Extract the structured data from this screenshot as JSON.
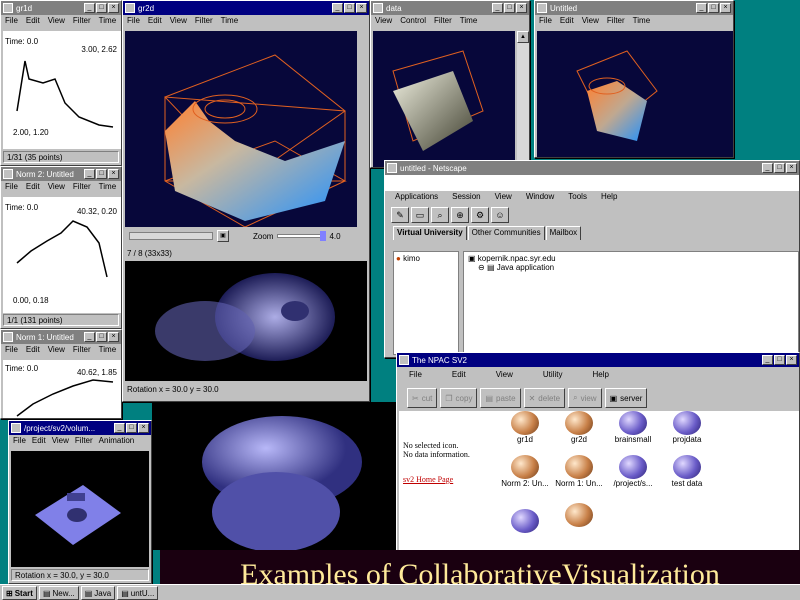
{
  "common_menu": [
    "File",
    "Edit",
    "View",
    "Filter",
    "Time"
  ],
  "win_gr1d": {
    "title": "gr1d",
    "time_label": "Time: 0.0",
    "coord_top": "3.00, 2.62",
    "coord_bottom": "2.00, 1.20",
    "status": "1/31 (35 points)"
  },
  "win_gr2d": {
    "title": "gr2d",
    "zoom_label": "Zoom",
    "slider_value": "4.0",
    "frame_label": "7 / 8 (33x33)",
    "rotation_label": "Rotation x = 30.0 y = 30.0"
  },
  "win_data": {
    "title": "data",
    "menu": [
      "View",
      "Control",
      "Filter",
      "Time"
    ]
  },
  "win_untitled_right": {
    "title": "Untitled",
    "menu": [
      "File",
      "Edit",
      "View",
      "Filter",
      "Time"
    ]
  },
  "win_norm2": {
    "title": "Norm 2: Untitled",
    "time_label": "Time: 0.0",
    "coord_top": "40.32, 0.20",
    "coord_bottom": "0.00, 0.18",
    "status": "1/1 (131 points)"
  },
  "win_norm1": {
    "title": "Norm 1: Untitled",
    "time_label": "Time: 0.0",
    "coord_top": "40.62, 1.85"
  },
  "win_volume": {
    "title": "/project/sv2/volum...",
    "menu": [
      "File",
      "Edit",
      "View",
      "Filter",
      "Animation"
    ],
    "rotation_label": "Rotation x = 30.0, y = 30.0"
  },
  "win_netscape": {
    "title": "untitled - Netscape",
    "menu": [
      "Applications",
      "Session",
      "View",
      "Window",
      "Tools",
      "Help"
    ],
    "tabs": [
      "Virtual University",
      "Other Communities",
      "Mailbox"
    ],
    "left_item": "kimo",
    "tree": [
      "kopernik.npac.syr.edu",
      "Java application"
    ]
  },
  "win_sv2": {
    "title": "The NPAC SV2",
    "menu": [
      "File",
      "Edit",
      "View",
      "Utility",
      "Help"
    ],
    "toolbar": [
      "cut",
      "copy",
      "paste",
      "delete",
      "view",
      "server"
    ],
    "side_text_1": "No selected icon.",
    "side_text_2": "No data information.",
    "side_link": "sv2 Home Page",
    "icons": [
      {
        "label": "gr1d",
        "color": "o"
      },
      {
        "label": "gr2d",
        "color": "o"
      },
      {
        "label": "brainsmall",
        "color": "p"
      },
      {
        "label": "projdata",
        "color": "p"
      },
      {
        "label": "Norm 2: Un...",
        "color": "o"
      },
      {
        "label": "Norm 1: Un...",
        "color": "o"
      },
      {
        "label": "/project/s...",
        "color": "p"
      },
      {
        "label": "test data",
        "color": "p"
      },
      {
        "label": "",
        "color": "p"
      },
      {
        "label": "",
        "color": "o"
      }
    ]
  },
  "taskbar": {
    "start": "Start",
    "items": [
      "New...",
      "Java",
      "untU..."
    ]
  },
  "caption": "Examples of CollaborativeVisualization"
}
